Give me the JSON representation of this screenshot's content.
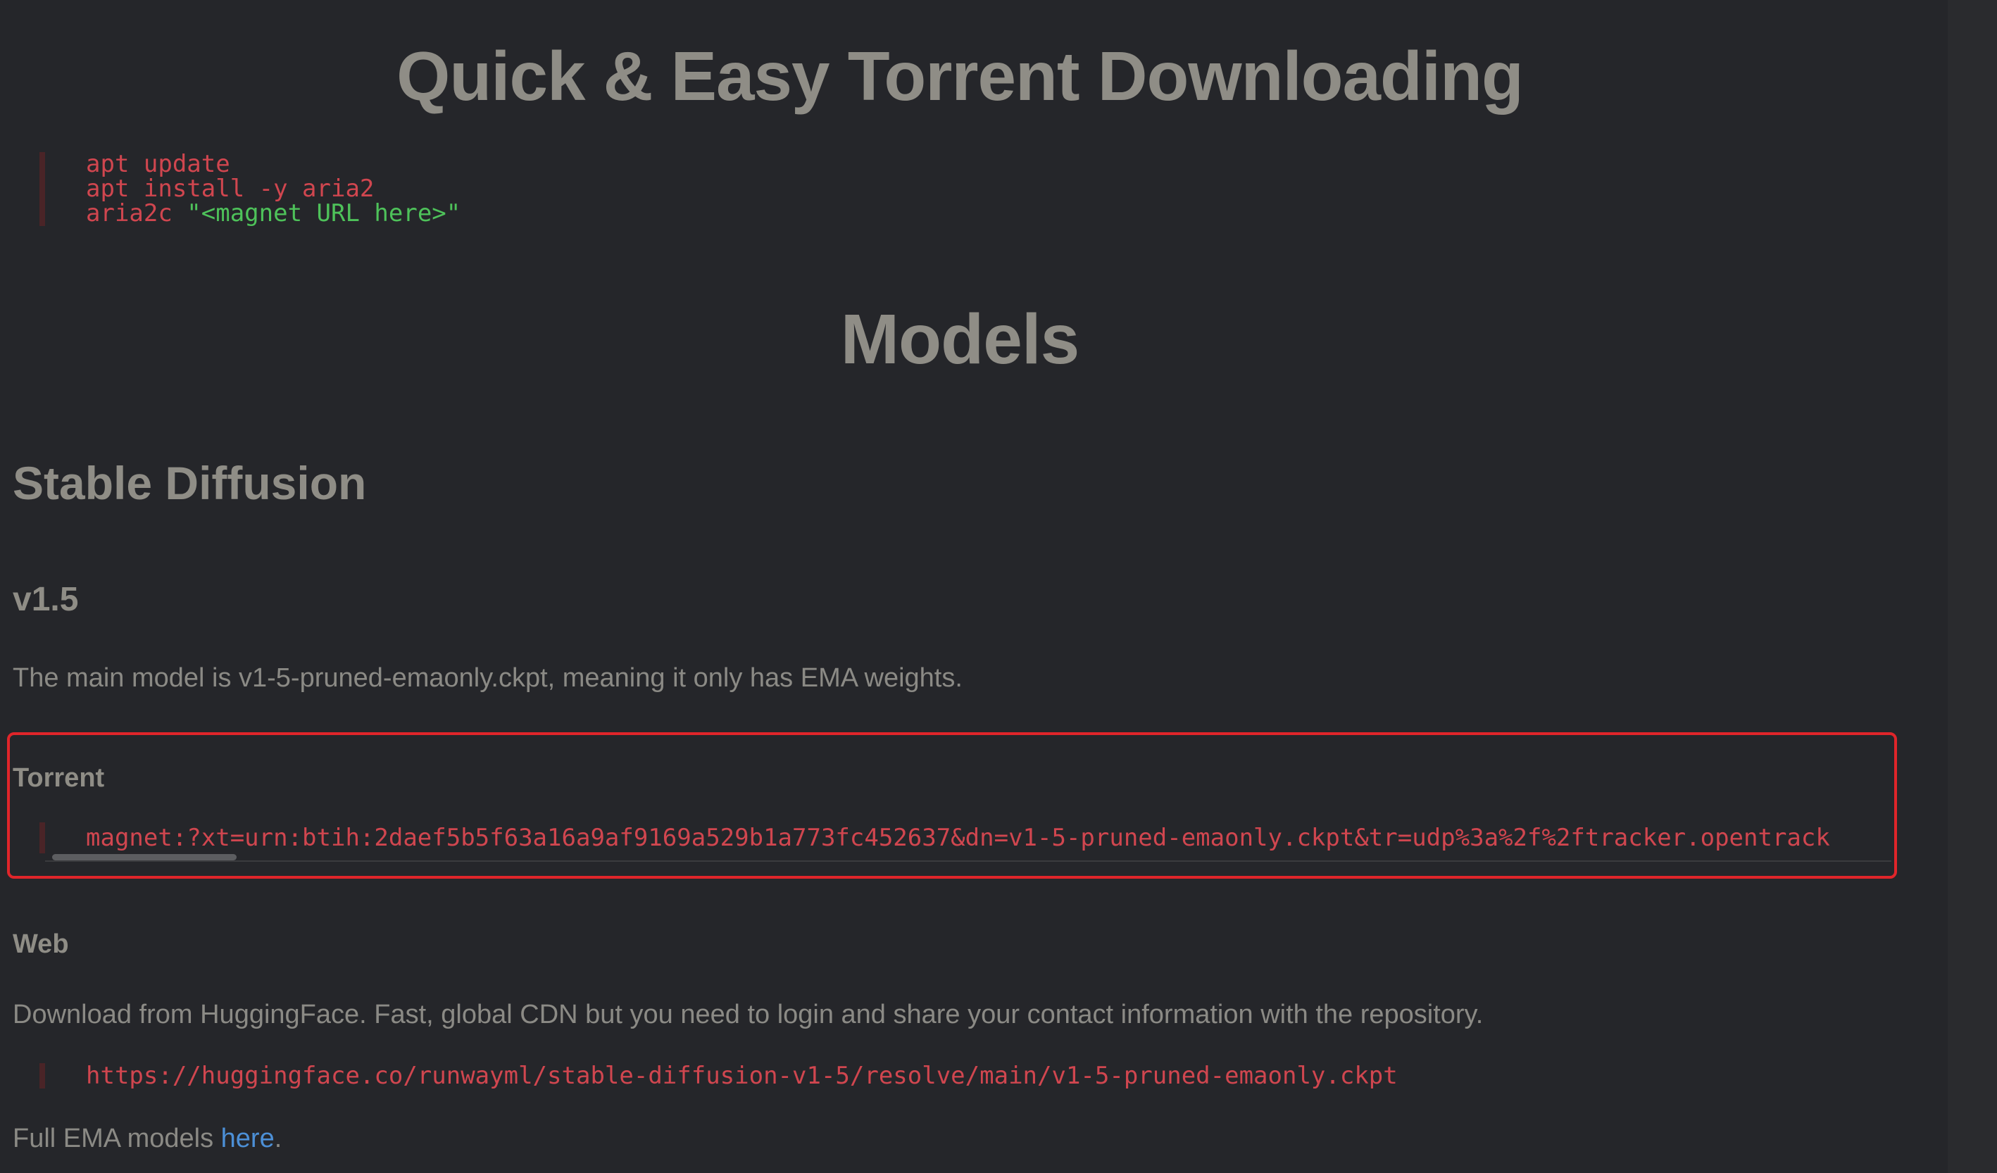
{
  "headings": {
    "title": "Quick & Easy Torrent Downloading",
    "models": "Models",
    "stable_diffusion": "Stable Diffusion",
    "version": "v1.5"
  },
  "install_code": {
    "line1": "apt update",
    "line2": "apt install -y aria2",
    "line3_cmd": "aria2c ",
    "line3_arg": "\"<magnet URL here>\""
  },
  "description": "The main model is v1-5-pruned-emaonly.ckpt, meaning it only has EMA weights.",
  "torrent": {
    "label": "Torrent",
    "magnet": "magnet:?xt=urn:btih:2daef5b5f63a16a9af9169a529b1a773fc452637&dn=v1-5-pruned-emaonly.ckpt&tr=udp%3a%2f%2ftracker.opentrack"
  },
  "web": {
    "label": "Web",
    "description": "Download from HuggingFace. Fast, global CDN but you need to login and share your contact information with the repository.",
    "url": "https://huggingface.co/runwayml/stable-diffusion-v1-5/resolve/main/v1-5-pruned-emaonly.ckpt"
  },
  "full_ema": {
    "prefix": "Full EMA models ",
    "link_text": "here",
    "suffix": "."
  },
  "colors": {
    "background": "#25262a",
    "heading": "#8f8d86",
    "code_red": "#d0464f",
    "code_string": "#4ec25a",
    "link": "#4c8fd6",
    "highlight_border": "#e0252a"
  }
}
